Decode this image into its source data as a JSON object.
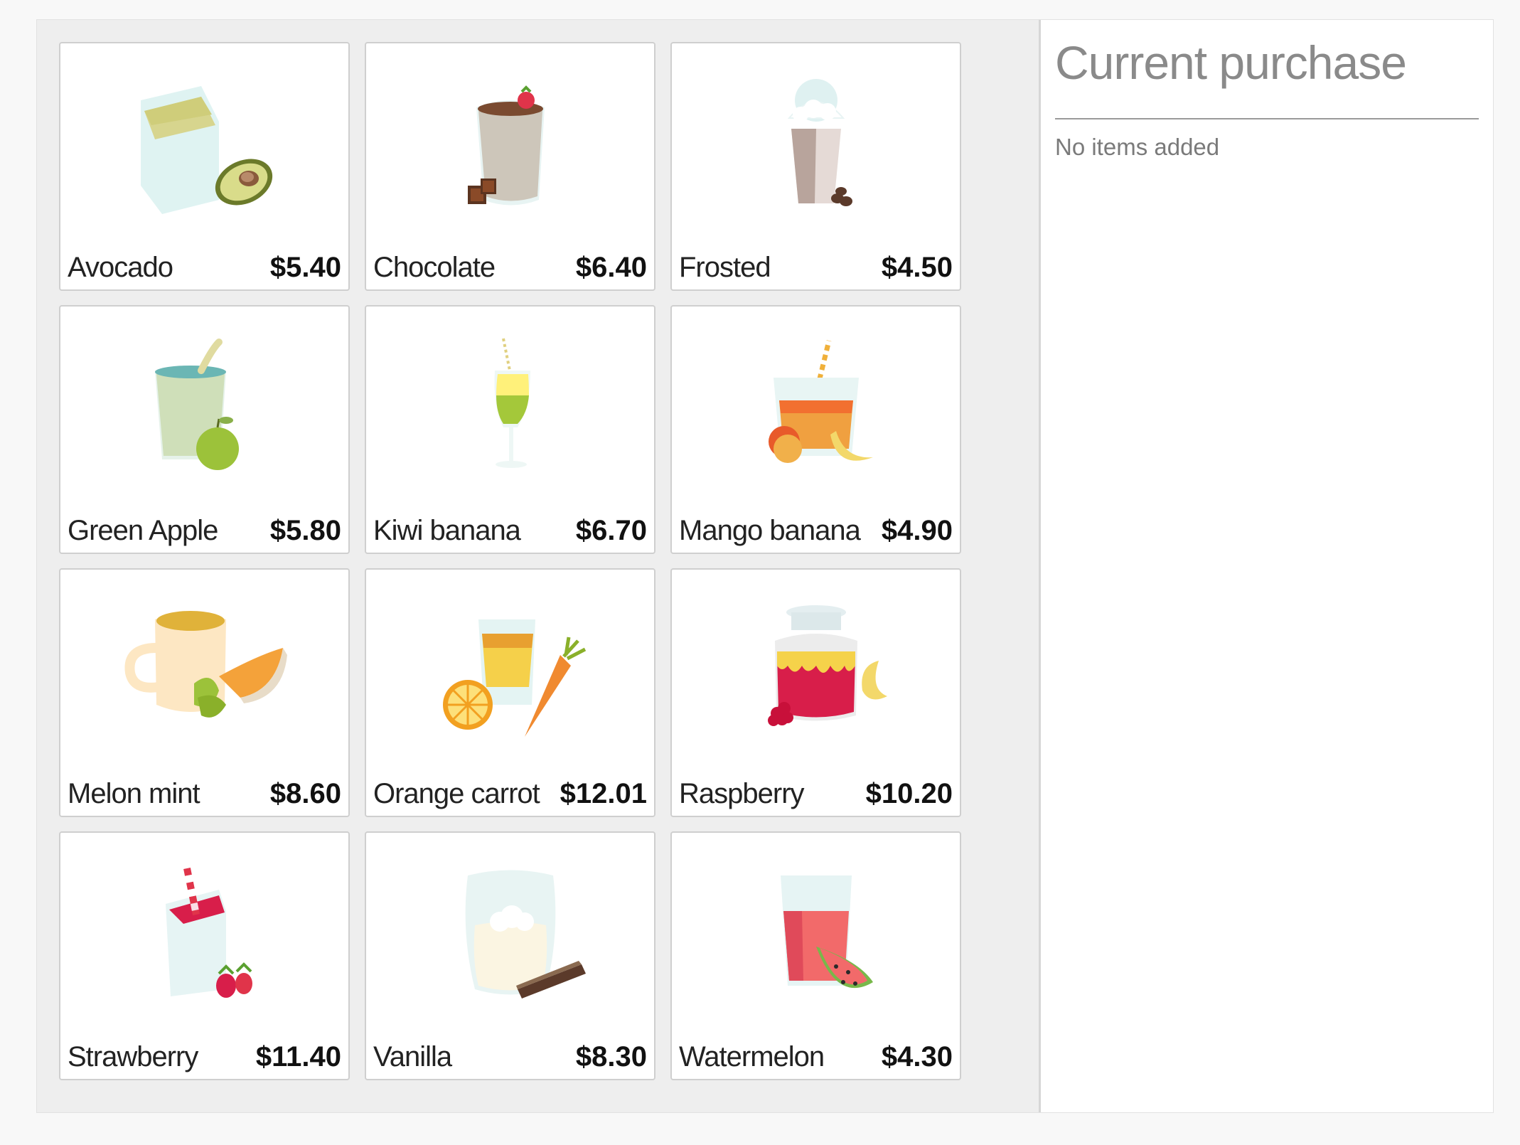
{
  "products": [
    {
      "name": "Avocado",
      "price": "$5.40",
      "icon": "avocado-smoothie-icon"
    },
    {
      "name": "Chocolate",
      "price": "$6.40",
      "icon": "chocolate-smoothie-icon"
    },
    {
      "name": "Frosted",
      "price": "$4.50",
      "icon": "frosted-smoothie-icon"
    },
    {
      "name": "Green Apple",
      "price": "$5.80",
      "icon": "green-apple-smoothie-icon"
    },
    {
      "name": "Kiwi banana",
      "price": "$6.70",
      "icon": "kiwi-banana-smoothie-icon"
    },
    {
      "name": "Mango banana",
      "price": "$4.90",
      "icon": "mango-banana-smoothie-icon"
    },
    {
      "name": "Melon mint",
      "price": "$8.60",
      "icon": "melon-mint-smoothie-icon"
    },
    {
      "name": "Orange carrot",
      "price": "$12.01",
      "icon": "orange-carrot-smoothie-icon"
    },
    {
      "name": "Raspberry",
      "price": "$10.20",
      "icon": "raspberry-smoothie-icon"
    },
    {
      "name": "Strawberry",
      "price": "$11.40",
      "icon": "strawberry-smoothie-icon"
    },
    {
      "name": "Vanilla",
      "price": "$8.30",
      "icon": "vanilla-smoothie-icon"
    },
    {
      "name": "Watermelon",
      "price": "$4.30",
      "icon": "watermelon-smoothie-icon"
    }
  ],
  "purchase": {
    "title": "Current purchase",
    "empty_text": "No items added"
  }
}
